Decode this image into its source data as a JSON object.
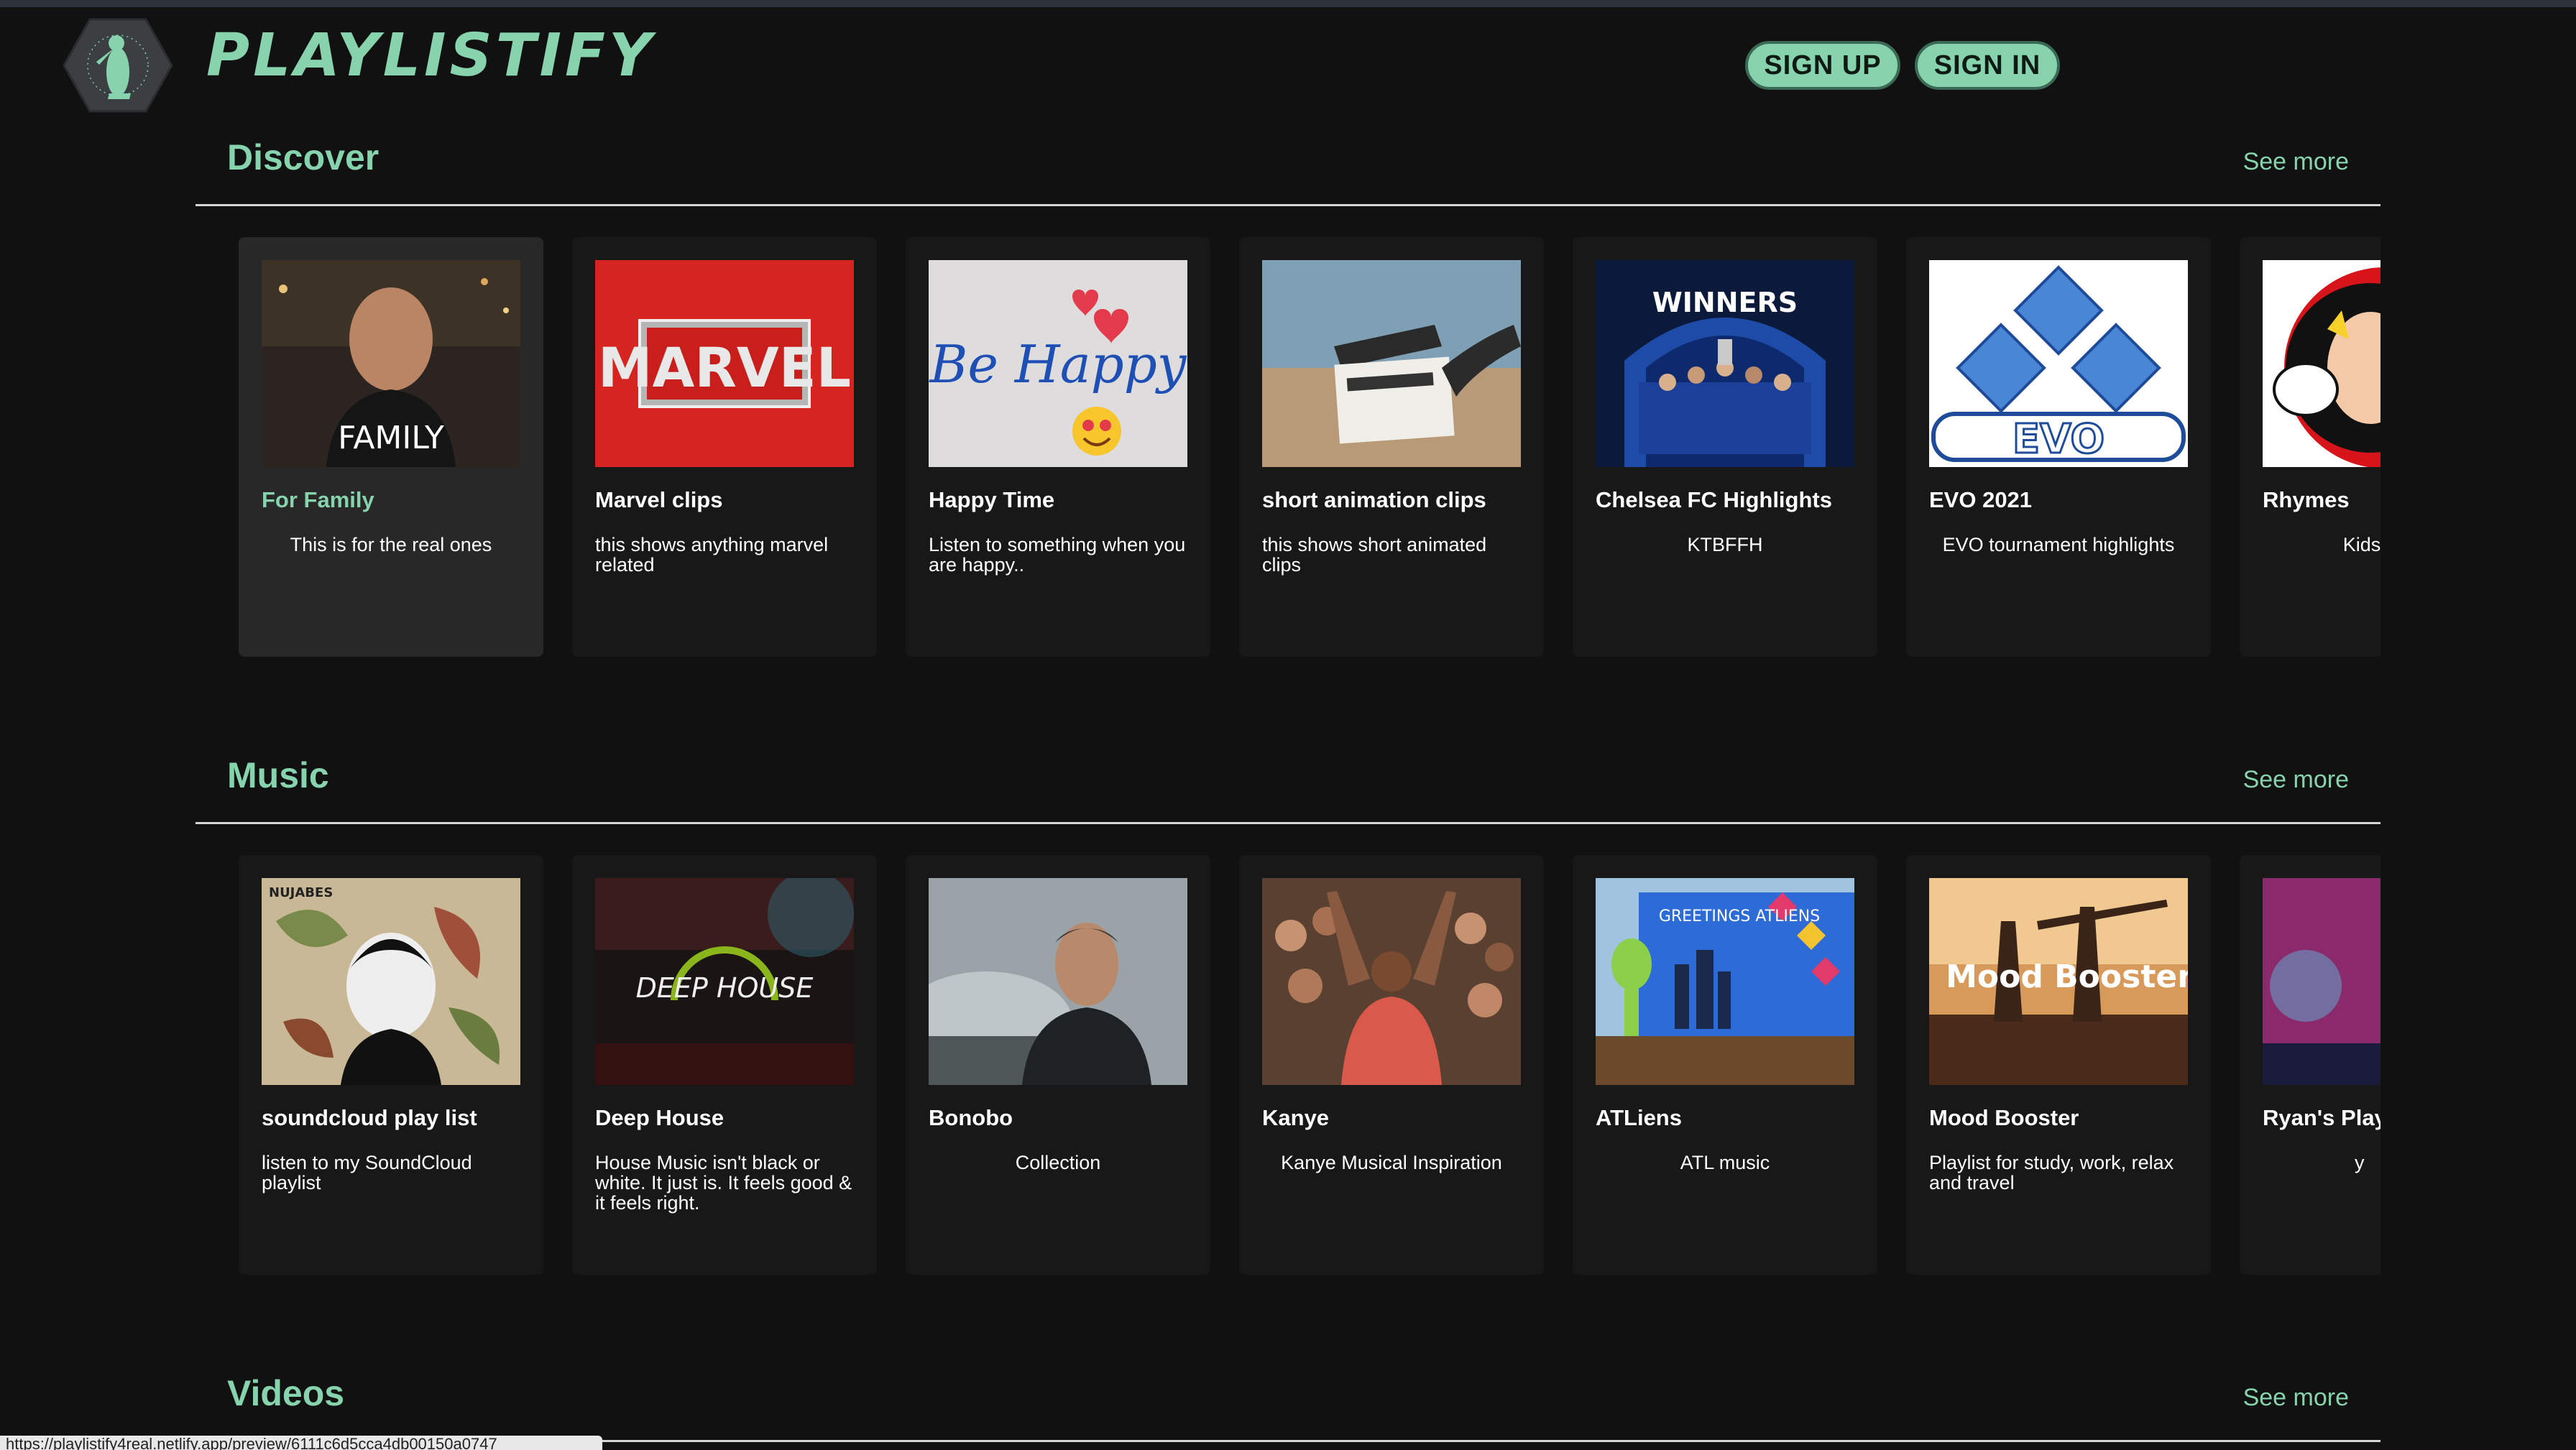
{
  "brand": {
    "name": "PLAYLISTIFY",
    "logo_icon": "penguin-hexagon-logo-icon"
  },
  "auth": {
    "sign_up": "SIGN UP",
    "sign_in": "SIGN IN"
  },
  "colors": {
    "accent": "#86d3ad",
    "background": "#111111",
    "card": "#181818",
    "card_active": "#282828"
  },
  "sections": [
    {
      "title": "Discover",
      "see_more": "See more",
      "cards": [
        {
          "title": "For Family",
          "desc": "This is for the real ones",
          "thumb_text": "FAMILY"
        },
        {
          "title": "Marvel clips",
          "desc": "this shows anything marvel related",
          "thumb_text": "MARVEL"
        },
        {
          "title": "Happy Time",
          "desc": "Listen to something when you are happy..",
          "thumb_text": "Be Happy"
        },
        {
          "title": "short animation clips",
          "desc": "this shows short animated clips"
        },
        {
          "title": "Chelsea FC Highlights",
          "desc": "KTBFFH",
          "thumb_text": "WINNERS"
        },
        {
          "title": "EVO 2021",
          "desc": "EVO tournament highlights",
          "thumb_text": "EVO"
        },
        {
          "title": "Rhymes",
          "desc": "Kids Educa"
        }
      ]
    },
    {
      "title": "Music",
      "see_more": "See more",
      "cards": [
        {
          "title": "soundcloud play list",
          "desc": "listen to my SoundCloud playlist",
          "thumb_text": "NUJABES"
        },
        {
          "title": "Deep House",
          "desc": "House Music isn't black or white. It just is. It feels good & it feels right.",
          "thumb_text": "DEEP HOUSE"
        },
        {
          "title": "Bonobo",
          "desc": "Collection"
        },
        {
          "title": "Kanye",
          "desc": "Kanye Musical Inspiration"
        },
        {
          "title": "ATLiens",
          "desc": "ATL music",
          "thumb_text": "GREETINGS ATLIENS"
        },
        {
          "title": "Mood Booster",
          "desc": "Playlist for study, work, relax and travel",
          "thumb_text": "Mood Booster"
        },
        {
          "title": "Ryan's Playl",
          "desc": "y"
        }
      ]
    },
    {
      "title": "Videos",
      "see_more": "See more"
    }
  ],
  "status_url": "https://playlistify4real.netlify.app/preview/6111c6d5cca4db00150a0747"
}
